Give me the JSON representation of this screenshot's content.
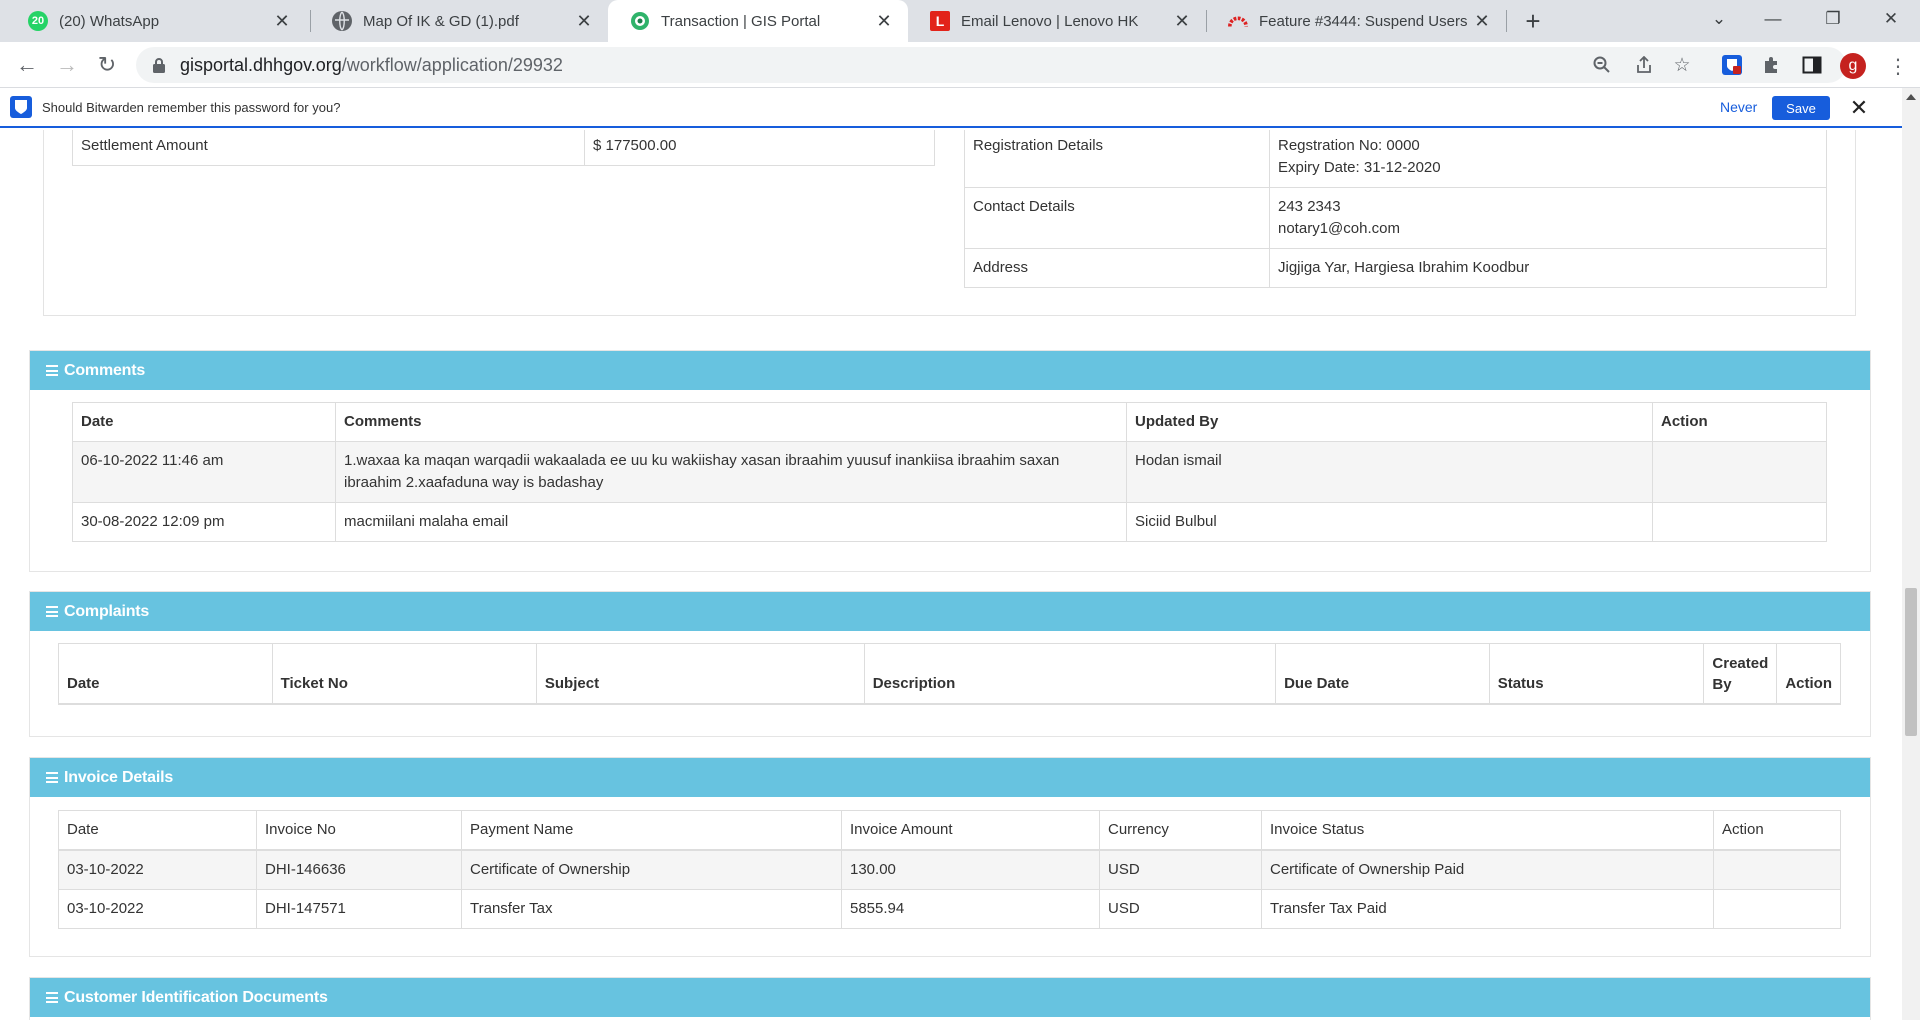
{
  "browser": {
    "tabs": [
      {
        "title": "(20) WhatsApp",
        "favicon": "whatsapp-icon",
        "badge": "20",
        "active": false
      },
      {
        "title": "Map Of IK & GD (1).pdf",
        "favicon": "globe-icon",
        "active": false
      },
      {
        "title": "Transaction | GIS Portal",
        "favicon": "gis-portal-icon",
        "active": true
      },
      {
        "title": "Email Lenovo | Lenovo HK",
        "favicon": "lenovo-icon",
        "badge": "L",
        "active": false
      },
      {
        "title": "Feature #3444: Suspend Users - ",
        "favicon": "redmine-icon",
        "active": false
      }
    ],
    "url_host": "gisportal.dhhgov.org",
    "url_path": "/workflow/application/29932",
    "avatar_letter": "g"
  },
  "bitwarden": {
    "message": "Should Bitwarden remember this password for you?",
    "never_label": "Never",
    "save_label": "Save"
  },
  "top_section": {
    "settlement": {
      "label": "Settlement Amount",
      "value": "$ 177500.00"
    },
    "notary": [
      {
        "label": "Registration Details",
        "lines": [
          "Regstration No: 0000",
          "Expiry Date: 31-12-2020"
        ]
      },
      {
        "label": "Contact Details",
        "lines": [
          "243 2343",
          "notary1@coh.com"
        ]
      },
      {
        "label": "Address",
        "lines": [
          "Jigjiga Yar, Hargiesa Ibrahim Koodbur"
        ]
      }
    ]
  },
  "comments": {
    "title": "Comments",
    "headers": [
      "Date",
      "Comments",
      "Updated By",
      "Action"
    ],
    "rows": [
      {
        "date": "06-10-2022 11:46 am",
        "comment": "1.waxaa ka maqan warqadii wakaalada ee uu ku wakiishay xasan ibraahim yuusuf inankiisa ibraahim saxan ibraahim 2.xaafaduna way is badashay",
        "updated_by": "Hodan ismail",
        "action": ""
      },
      {
        "date": "30-08-2022 12:09 pm",
        "comment": "macmiilani malaha email",
        "updated_by": "Siciid Bulbul",
        "action": ""
      }
    ]
  },
  "complaints": {
    "title": "Complaints",
    "headers": [
      "Date",
      "Ticket No",
      "Subject",
      "Description",
      "Due Date",
      "Status",
      "Created By",
      "Action"
    ]
  },
  "invoices": {
    "title": "Invoice Details",
    "headers": [
      "Date",
      "Invoice No",
      "Payment Name",
      "Invoice Amount",
      "Currency",
      "Invoice Status",
      "Action"
    ],
    "rows": [
      {
        "date": "03-10-2022",
        "invoice_no": "DHI-146636",
        "payment_name": "Certificate of Ownership",
        "amount": "130.00",
        "currency": "USD",
        "status": "Certificate of Ownership Paid",
        "action": ""
      },
      {
        "date": "03-10-2022",
        "invoice_no": "DHI-147571",
        "payment_name": "Transfer Tax",
        "amount": "5855.94",
        "currency": "USD",
        "status": "Transfer Tax Paid",
        "action": ""
      }
    ]
  },
  "customer_docs": {
    "title": "Customer Identification Documents"
  },
  "colors": {
    "panel_header": "#67c3e0",
    "bitwarden_blue": "#175ddc"
  }
}
